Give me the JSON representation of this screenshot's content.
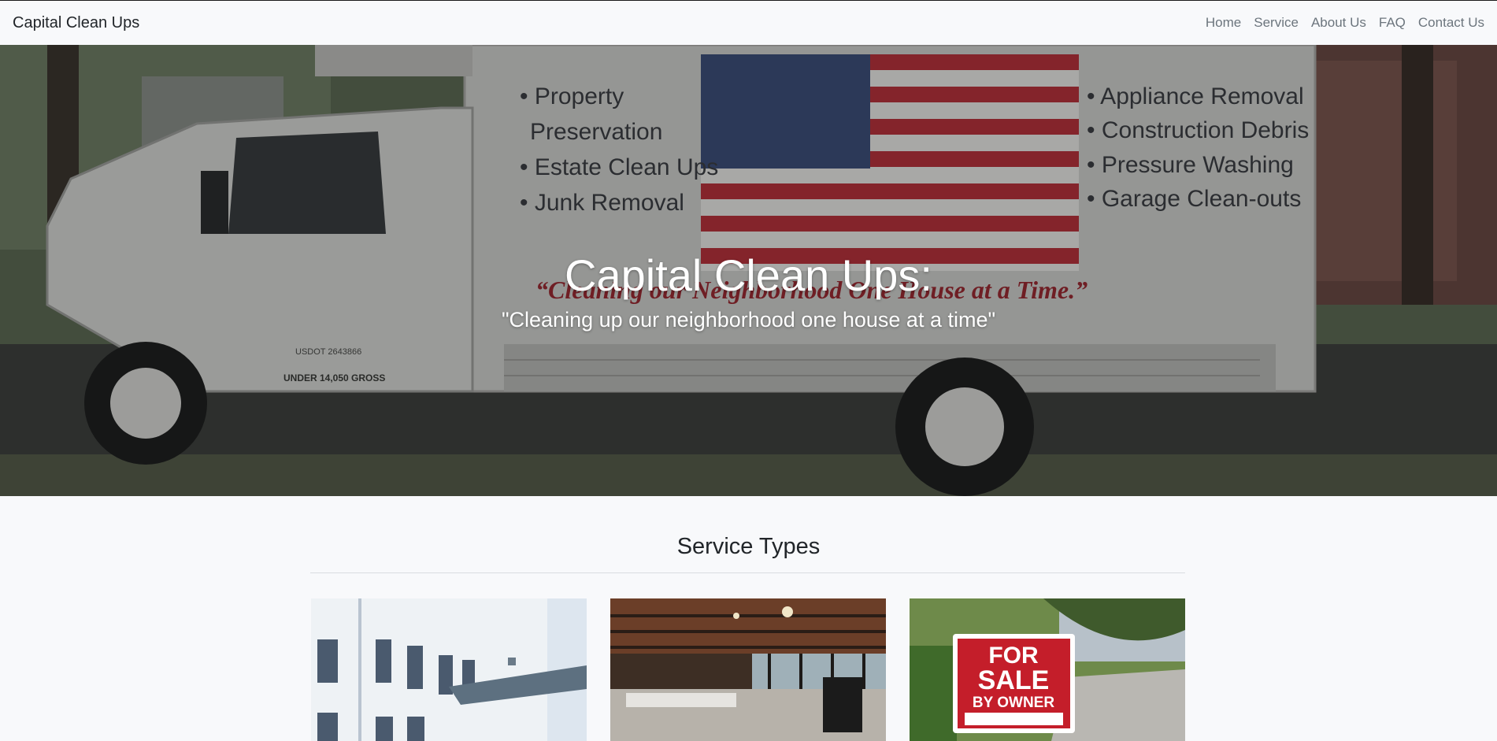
{
  "navbar": {
    "brand": "Capital Clean Ups",
    "links": [
      {
        "label": "Home"
      },
      {
        "label": "Service"
      },
      {
        "label": "About Us"
      },
      {
        "label": "FAQ"
      },
      {
        "label": "Contact Us"
      }
    ]
  },
  "hero": {
    "title": "Capital Clean Ups:",
    "subtitle": "\"Cleaning up our neighborhood one house at a time\"",
    "truck": {
      "left_services": [
        "• Property",
        "Preservation",
        "• Estate Clean Ups",
        "• Junk Removal"
      ],
      "right_services": [
        "• Appliance Removal",
        "• Construction Debris",
        "• Pressure Washing",
        "• Garage Clean-outs"
      ],
      "slogan": "“Cleaning our Neighborhood One House at a Time.”",
      "door_text_1": "USDOT 2643866",
      "door_text_2": "UNDER 14,050 GROSS"
    }
  },
  "services": {
    "title": "Service Types",
    "cards": [
      {
        "image": "commercial-building-photo"
      },
      {
        "image": "office-interior-photo"
      },
      {
        "image": "for-sale-sign-photo",
        "sign_line_1": "FOR",
        "sign_line_2": "SALE",
        "sign_line_3": "BY OWNER"
      }
    ]
  },
  "colors": {
    "nav_bg": "#f8f9fb",
    "nav_link": "#6c757d",
    "brand": "#212529",
    "hero_text": "#ffffff",
    "sign_red": "#c41e2a"
  }
}
